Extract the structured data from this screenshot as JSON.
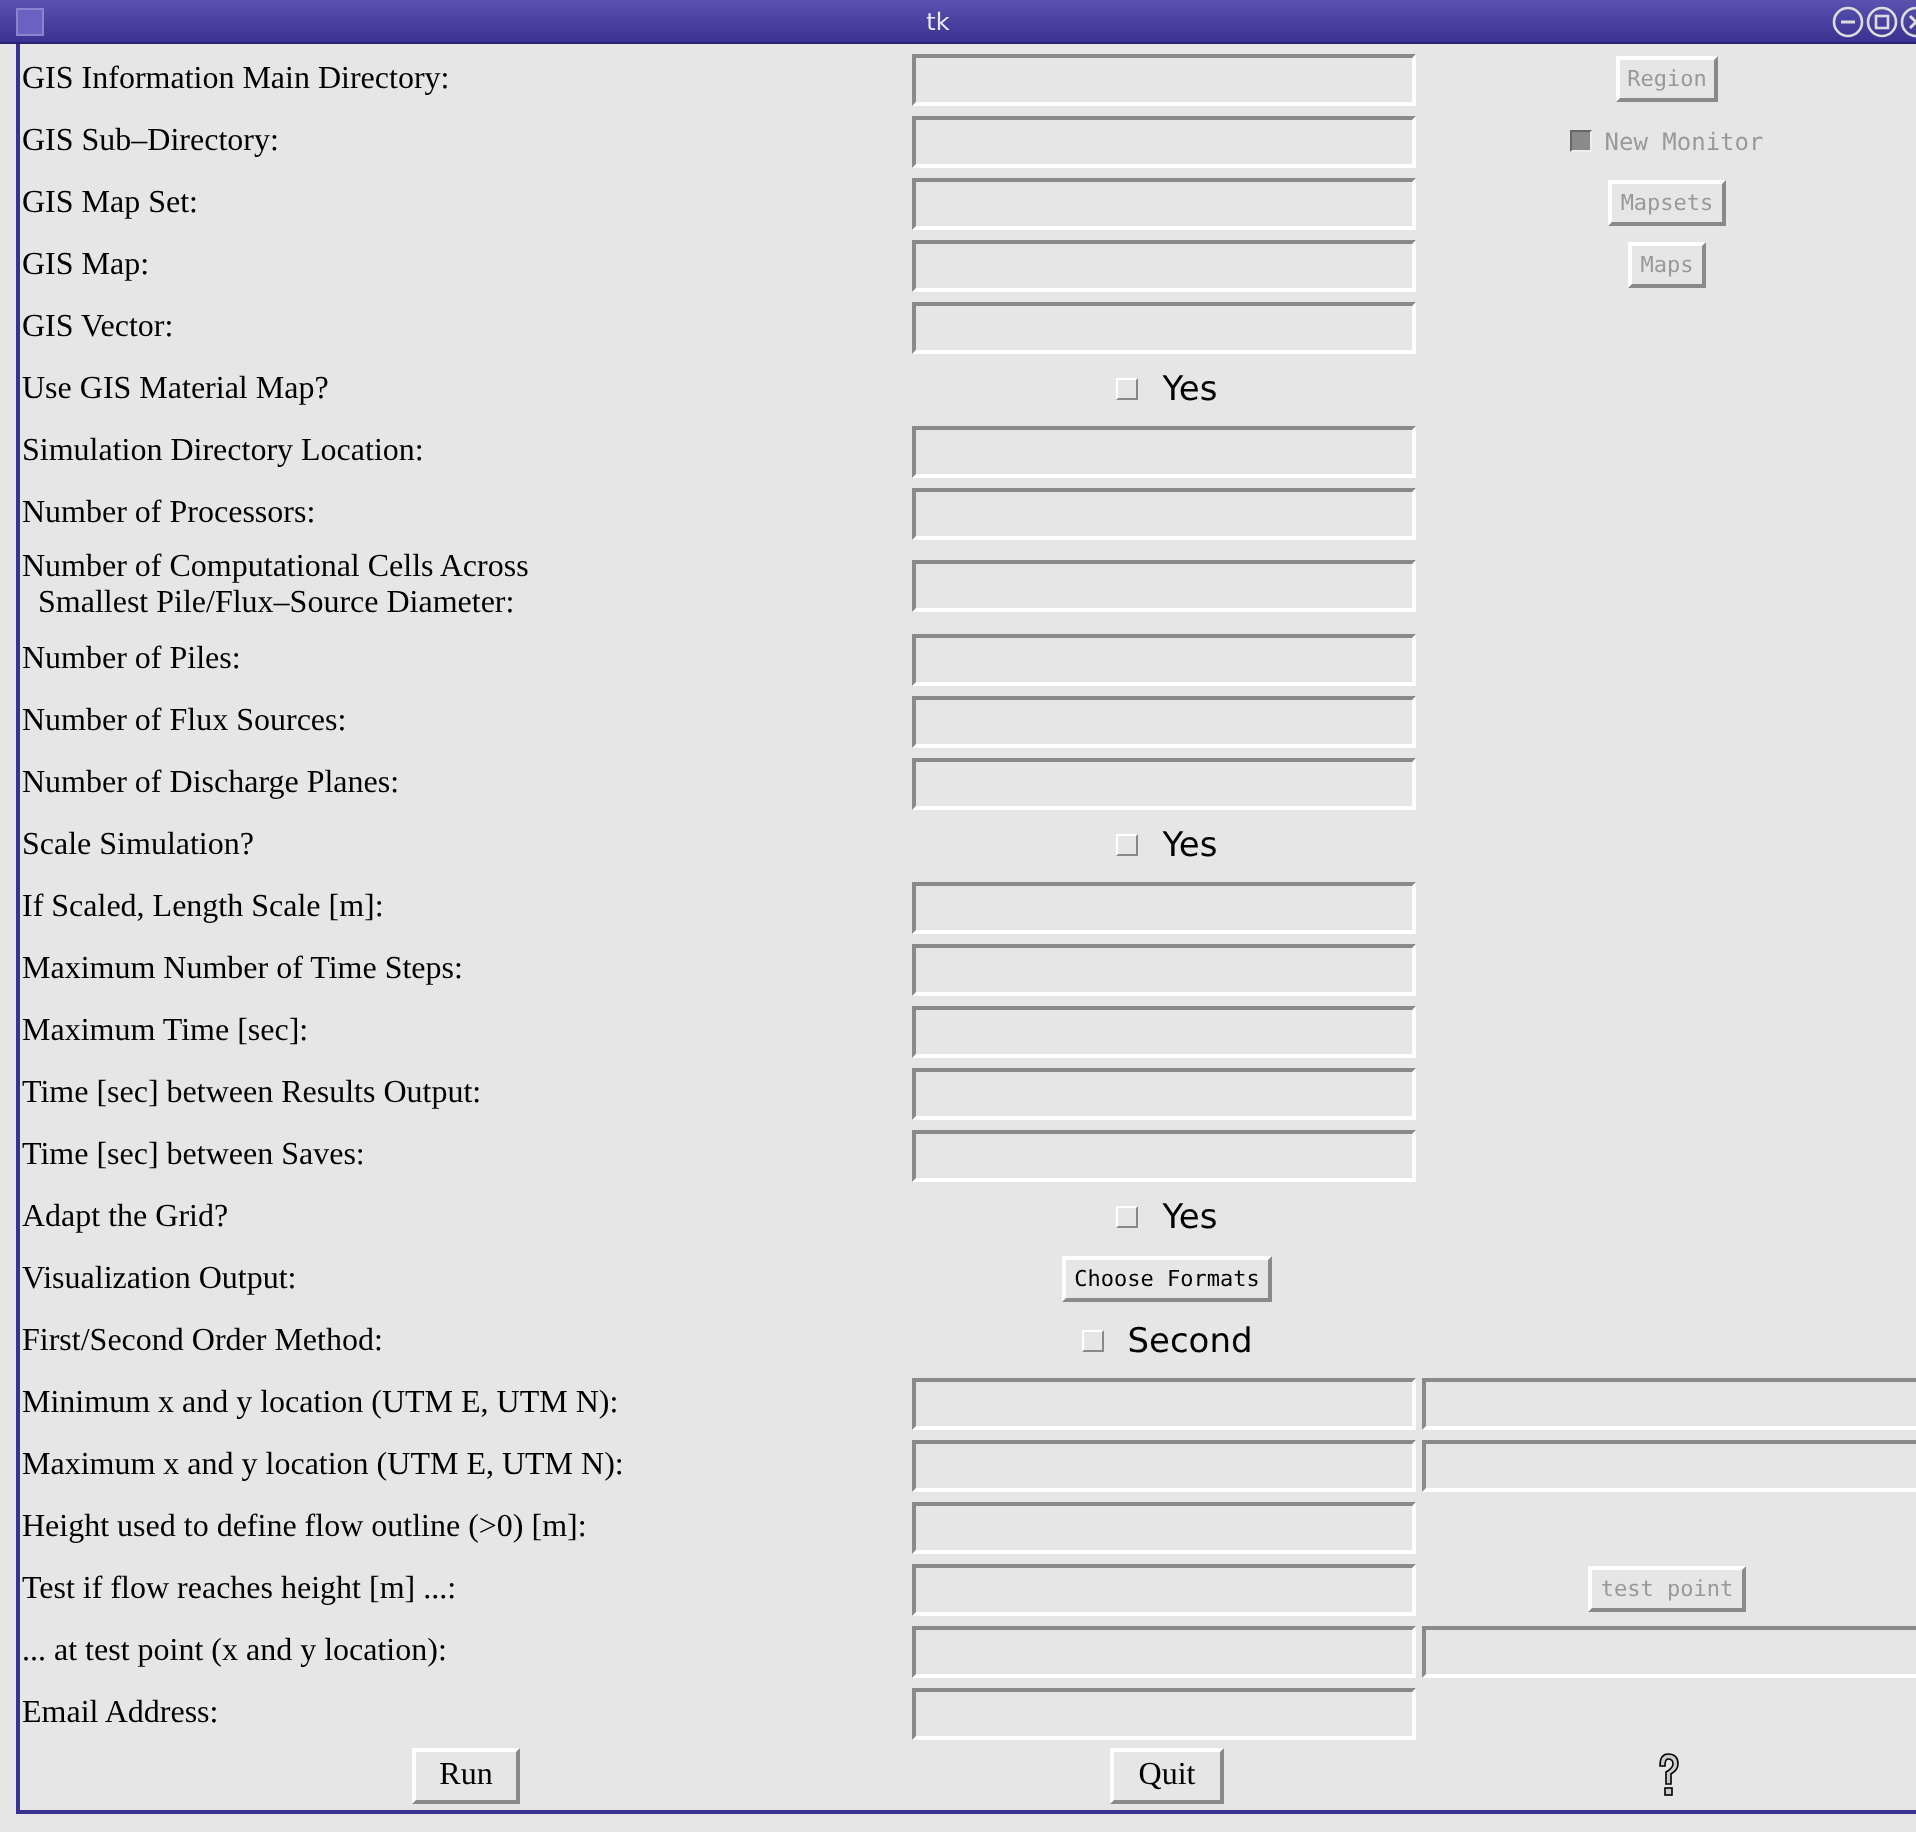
{
  "window": {
    "title": "tk"
  },
  "rows": [
    {
      "label": "GIS Information Main Directory:",
      "kind": "entry",
      "side": {
        "kind": "button",
        "label": "Region",
        "disabled": true
      }
    },
    {
      "label": "GIS Sub–Directory:",
      "kind": "entry",
      "side": {
        "kind": "check",
        "label": "New Monitor",
        "checked": true,
        "disabled": true
      }
    },
    {
      "label": "GIS Map Set:",
      "kind": "entry",
      "side": {
        "kind": "button",
        "label": "Mapsets",
        "disabled": true
      }
    },
    {
      "label": "GIS Map:",
      "kind": "entry",
      "side": {
        "kind": "button",
        "label": "Maps",
        "disabled": true
      }
    },
    {
      "label": "GIS Vector:",
      "kind": "entry"
    },
    {
      "label": "Use GIS Material Map?",
      "kind": "check",
      "option": "Yes",
      "checked": false
    },
    {
      "label": "Simulation Directory Location:",
      "kind": "entry"
    },
    {
      "label": "Number of Processors:",
      "kind": "entry"
    },
    {
      "label": "Number of Computational Cells Across\n  Smallest Pile/Flux–Source Diameter:",
      "kind": "entry"
    },
    {
      "label": "Number of Piles:",
      "kind": "entry"
    },
    {
      "label": "Number of Flux Sources:",
      "kind": "entry"
    },
    {
      "label": "Number of Discharge Planes:",
      "kind": "entry"
    },
    {
      "label": "Scale Simulation?",
      "kind": "check",
      "option": "Yes",
      "checked": false
    },
    {
      "label": "If Scaled, Length Scale [m]:",
      "kind": "entry"
    },
    {
      "label": "Maximum Number of Time Steps:",
      "kind": "entry"
    },
    {
      "label": "Maximum Time [sec]:",
      "kind": "entry"
    },
    {
      "label": "Time [sec] between Results Output:",
      "kind": "entry"
    },
    {
      "label": "Time [sec] between Saves:",
      "kind": "entry"
    },
    {
      "label": "Adapt the Grid?",
      "kind": "check",
      "option": "Yes",
      "checked": false
    },
    {
      "label": "Visualization Output:",
      "kind": "button",
      "option": "Choose Formats"
    },
    {
      "label": "First/Second Order Method:",
      "kind": "check",
      "option": "Second",
      "checked": false
    },
    {
      "label": "Minimum x and y location (UTM E, UTM N):",
      "kind": "pair"
    },
    {
      "label": "Maximum x and y location (UTM E, UTM N):",
      "kind": "pair"
    },
    {
      "label": "Height used to define flow outline (>0) [m]:",
      "kind": "entry"
    },
    {
      "label": "Test if flow reaches height [m] ...:",
      "kind": "entry",
      "side": {
        "kind": "button",
        "label": "test point",
        "disabled": true
      }
    },
    {
      "label": "... at test point (x and y location):",
      "kind": "pair"
    },
    {
      "label": "Email Address:",
      "kind": "entry"
    }
  ],
  "buttons": [
    {
      "label": "Run"
    },
    {
      "label": "Quit"
    }
  ]
}
